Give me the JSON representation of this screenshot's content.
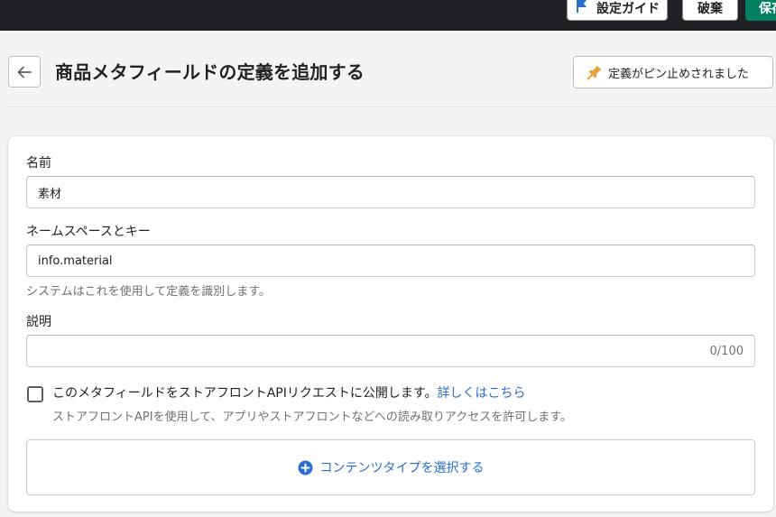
{
  "topbar": {
    "guide_label": "設定ガイド",
    "discard_label": "破棄",
    "save_label": "保存"
  },
  "header": {
    "title": "商品メタフィールドの定義を追加する",
    "pin_label": "定義がピン止めされました"
  },
  "form": {
    "name_label": "名前",
    "name_value": "素材",
    "namespace_label": "ネームスペースとキー",
    "namespace_value": "info.material",
    "namespace_help": "システムはこれを使用して定義を識別します。",
    "description_label": "説明",
    "description_value": "",
    "description_counter": "0/100",
    "storefront_label": "このメタフィールドをストアフロントAPIリクエストに公開します。",
    "storefront_link": "詳しくはこちら",
    "storefront_help": "ストアフロントAPIを使用して、アプリやストアフロントなどへの読み取りアクセスを許可します。",
    "storefront_checked": false,
    "content_type_label": "コンテンツタイプを選択する"
  },
  "colors": {
    "primary": "#008060",
    "link": "#2c6ecb",
    "pin_icon": "#e6a23c",
    "topbar": "#1f2124"
  },
  "icons": {
    "guide": "flag-icon",
    "back": "arrow-left-icon",
    "pin": "pin-icon",
    "add": "plus-circle-icon"
  }
}
